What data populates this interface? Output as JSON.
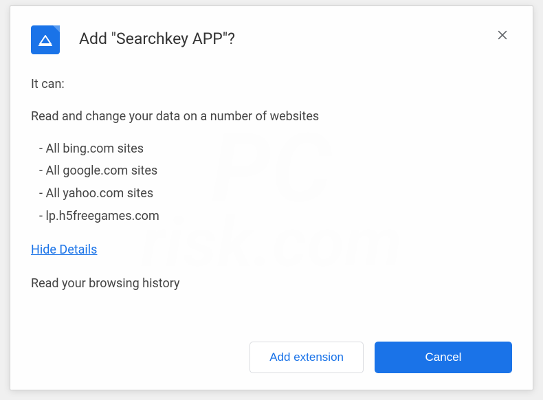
{
  "dialog": {
    "title": "Add \"Searchkey APP\"?",
    "permissions_intro": "It can:",
    "permission_heading": "Read and change your data on a number of websites",
    "sites": [
      "All bing.com sites",
      "All google.com sites",
      "All yahoo.com sites",
      "lp.h5freegames.com"
    ],
    "details_toggle": "Hide Details",
    "permission_extra": "Read your browsing history",
    "add_button": "Add extension",
    "cancel_button": "Cancel"
  },
  "watermark": {
    "line1": "PC",
    "line2": "risk.com"
  }
}
